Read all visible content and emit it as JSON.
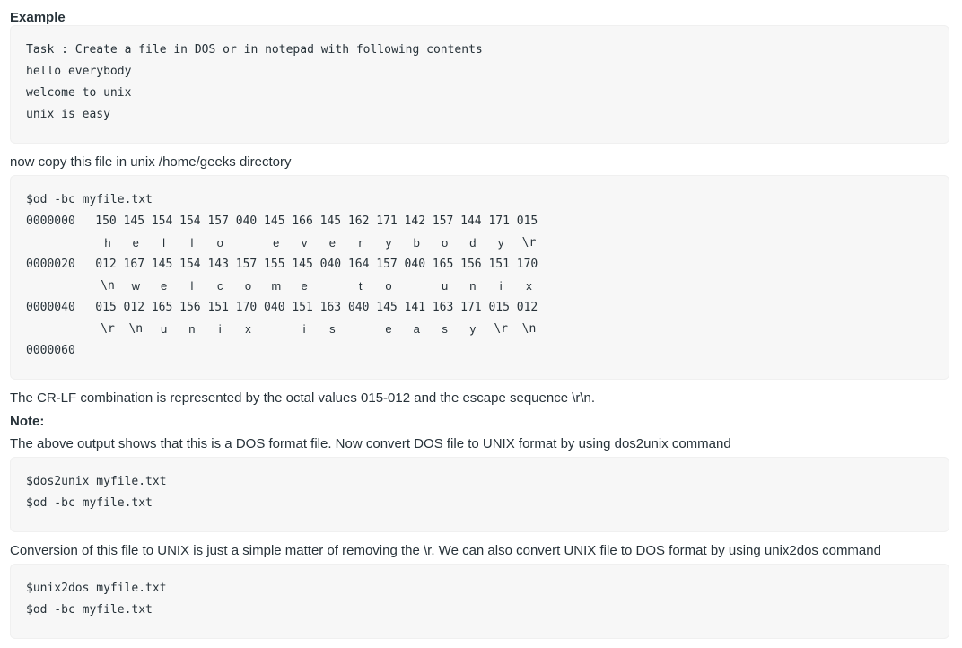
{
  "example_heading": "Example",
  "block1": {
    "lines": [
      "Task : Create a file in DOS or in notepad with following contents",
      "hello everybody",
      "welcome to unix",
      "unix is easy"
    ]
  },
  "para1": "now copy this file in unix /home/geeks directory",
  "block2": {
    "command": "$od -bc myfile.txt",
    "rows": [
      {
        "address": "0000000",
        "octal": [
          "150",
          "145",
          "154",
          "154",
          "157",
          "040",
          "145",
          "166",
          "145",
          "162",
          "171",
          "142",
          "157",
          "144",
          "171",
          "015"
        ],
        "chars": [
          "h",
          "e",
          "l",
          "l",
          "o",
          " ",
          "e",
          "v",
          "e",
          "r",
          "y",
          "b",
          "o",
          "d",
          "y",
          "\\r"
        ]
      },
      {
        "address": "0000020",
        "octal": [
          "012",
          "167",
          "145",
          "154",
          "143",
          "157",
          "155",
          "145",
          "040",
          "164",
          "157",
          "040",
          "165",
          "156",
          "151",
          "170"
        ],
        "chars": [
          "\\n",
          "w",
          "e",
          "l",
          "c",
          "o",
          "m",
          "e",
          " ",
          "t",
          "o",
          " ",
          "u",
          "n",
          "i",
          "x"
        ]
      },
      {
        "address": "0000040",
        "octal": [
          "015",
          "012",
          "165",
          "156",
          "151",
          "170",
          "040",
          "151",
          "163",
          "040",
          "145",
          "141",
          "163",
          "171",
          "015",
          "012"
        ],
        "chars": [
          "\\r",
          "\\n",
          "u",
          "n",
          "i",
          "x",
          " ",
          "i",
          "s",
          " ",
          "e",
          "a",
          "s",
          "y",
          "\\r",
          "\\n"
        ]
      }
    ],
    "end_address": "0000060"
  },
  "para2": "The CR-LF combination is represented by the octal values 015-012 and the escape sequence \\r\\n.",
  "note_heading": "Note:",
  "para3": "The above output shows that this is a DOS format file. Now convert DOS file to UNIX format by using dos2unix command",
  "block3": {
    "lines": [
      "$dos2unix myfile.txt",
      "$od -bc myfile.txt"
    ]
  },
  "para4": "Conversion of this file to UNIX is just a simple matter of removing the \\r. We can also convert UNIX file to DOS format by using unix2dos command",
  "block4": {
    "lines": [
      "$unix2dos myfile.txt",
      "$od -bc myfile.txt"
    ]
  }
}
